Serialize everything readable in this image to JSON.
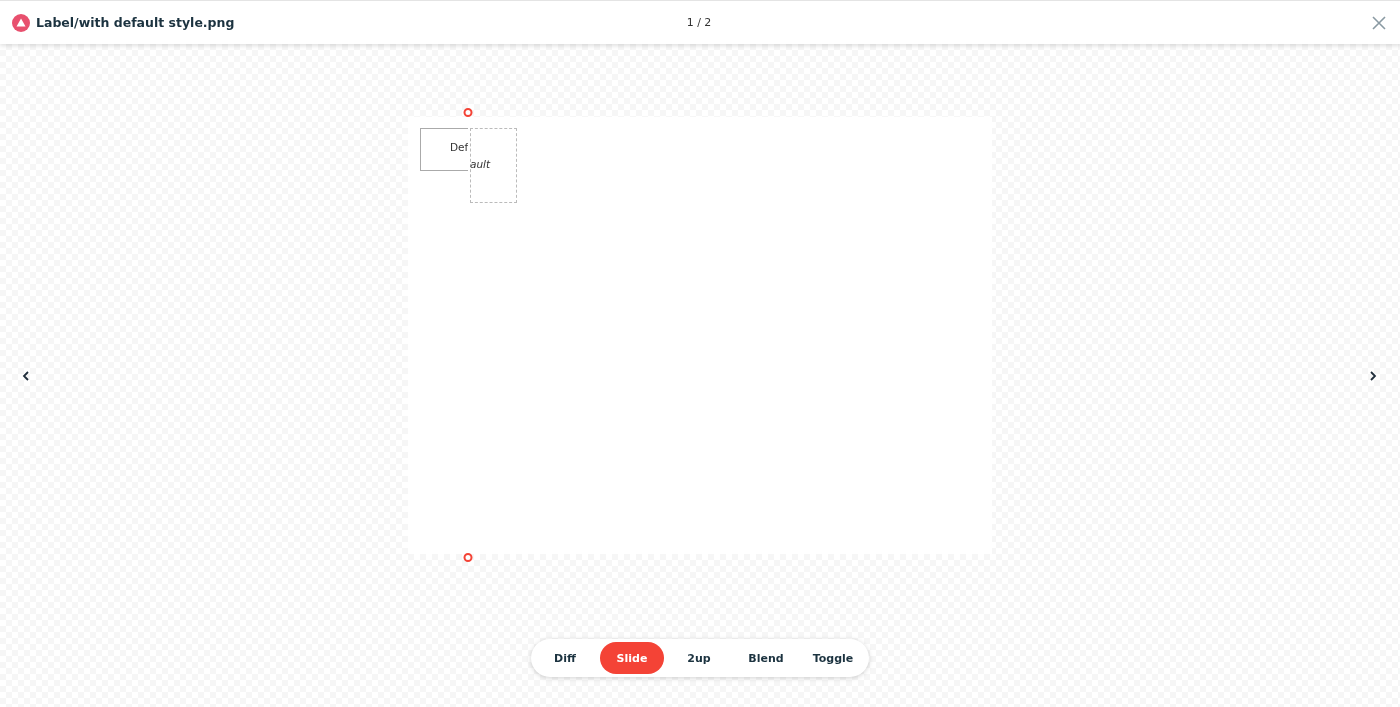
{
  "header": {
    "title": "Label/with default style.png",
    "counter": "1 / 2"
  },
  "comparison": {
    "level": 0.103,
    "before_text": "Def",
    "after_text": "ault"
  },
  "modes": [
    {
      "label": "Diff",
      "selected": false
    },
    {
      "label": "Slide",
      "selected": true
    },
    {
      "label": "2up",
      "selected": false
    },
    {
      "label": "Blend",
      "selected": false
    },
    {
      "label": "Toggle",
      "selected": false
    }
  ]
}
